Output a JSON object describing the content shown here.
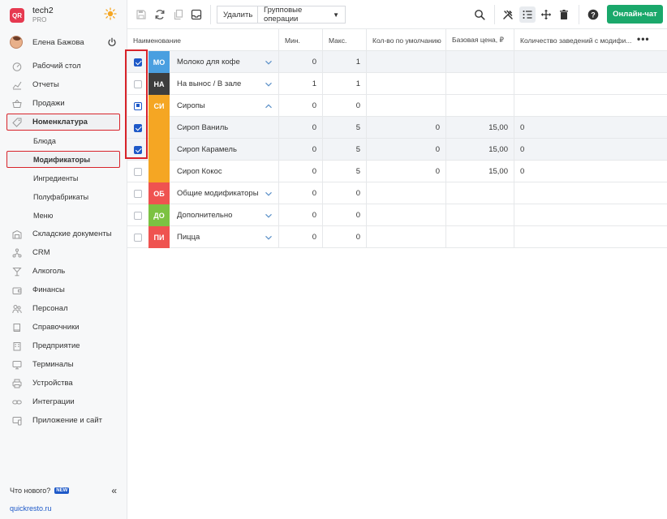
{
  "sidebar": {
    "brand": {
      "logo_text": "QR",
      "name": "tech2",
      "plan": "PRO"
    },
    "user": {
      "name": "Елена Бажова"
    },
    "nav": [
      {
        "label": "Рабочий стол",
        "icon": "dashboard-icon"
      },
      {
        "label": "Отчеты",
        "icon": "chart-icon"
      },
      {
        "label": "Продажи",
        "icon": "basket-icon"
      },
      {
        "label": "Номенклатура",
        "icon": "tag-icon",
        "highlighted": true,
        "children": [
          {
            "label": "Блюда"
          },
          {
            "label": "Модификаторы",
            "highlighted": true
          },
          {
            "label": "Ингредиенты"
          },
          {
            "label": "Полуфабрикаты"
          },
          {
            "label": "Меню"
          }
        ]
      },
      {
        "label": "Складские документы",
        "icon": "warehouse-icon"
      },
      {
        "label": "CRM",
        "icon": "crm-icon"
      },
      {
        "label": "Алкоголь",
        "icon": "glass-icon"
      },
      {
        "label": "Финансы",
        "icon": "wallet-icon"
      },
      {
        "label": "Персонал",
        "icon": "people-icon"
      },
      {
        "label": "Справочники",
        "icon": "book-icon"
      },
      {
        "label": "Предприятие",
        "icon": "building-icon"
      },
      {
        "label": "Терминалы",
        "icon": "terminal-icon"
      },
      {
        "label": "Устройства",
        "icon": "printer-icon"
      },
      {
        "label": "Интеграции",
        "icon": "link-icon"
      },
      {
        "label": "Приложение и сайт",
        "icon": "app-icon"
      }
    ],
    "whats_new": "Что нового?",
    "new_badge": "NEW",
    "site": "quickresto.ru"
  },
  "toolbar": {
    "delete_label": "Удалить",
    "group_ops_label": "Групповые операции",
    "chat_label": "Онлайн-чат"
  },
  "table": {
    "columns": [
      "Наименование",
      "Мин.",
      "Макс.",
      "Кол-во по умолчанию",
      "Базовая цена, ₽",
      "Количество заведений с модифи..."
    ],
    "rows": [
      {
        "check": "on",
        "tag": "МО",
        "tag_color": "#4a9fe0",
        "name": "Молоко для кофе",
        "min": "0",
        "max": "1",
        "def": "",
        "price": "",
        "cnt": "",
        "chevron": "down",
        "selected": true
      },
      {
        "check": "off",
        "tag": "НА",
        "tag_color": "#3d3d3d",
        "name": "На вынос / В зале",
        "min": "1",
        "max": "1",
        "def": "",
        "price": "",
        "cnt": "",
        "chevron": "down",
        "selected": false
      },
      {
        "check": "partial",
        "tag": "СИ",
        "tag_color": "#f5a623",
        "name": "Сиропы",
        "min": "0",
        "max": "0",
        "def": "",
        "price": "",
        "cnt": "",
        "chevron": "up",
        "selected": false
      },
      {
        "check": "on",
        "tag": "",
        "tag_color": "#f5a623",
        "name": "Сироп Ваниль",
        "min": "0",
        "max": "5",
        "def": "0",
        "price": "15,00",
        "cnt": "0",
        "chevron": "",
        "selected": true
      },
      {
        "check": "on",
        "tag": "",
        "tag_color": "#f5a623",
        "name": "Сироп Карамель",
        "min": "0",
        "max": "5",
        "def": "0",
        "price": "15,00",
        "cnt": "0",
        "chevron": "",
        "selected": true
      },
      {
        "check": "off",
        "tag": "",
        "tag_color": "#f5a623",
        "name": "Сироп Кокос",
        "min": "0",
        "max": "5",
        "def": "0",
        "price": "15,00",
        "cnt": "0",
        "chevron": "",
        "selected": false
      },
      {
        "check": "off",
        "tag": "ОБ",
        "tag_color": "#ef5350",
        "name": "Общие модификаторы",
        "min": "0",
        "max": "0",
        "def": "",
        "price": "",
        "cnt": "",
        "chevron": "down",
        "selected": false
      },
      {
        "check": "off",
        "tag": "ДО",
        "tag_color": "#7cc242",
        "name": "Дополнительно",
        "min": "0",
        "max": "0",
        "def": "",
        "price": "",
        "cnt": "",
        "chevron": "down",
        "selected": false
      },
      {
        "check": "off",
        "tag": "ПИ",
        "tag_color": "#ef5350",
        "name": "Пицца",
        "min": "0",
        "max": "0",
        "def": "",
        "price": "",
        "cnt": "",
        "chevron": "down",
        "selected": false
      }
    ]
  },
  "colors": {
    "accent": "#1e59c8",
    "highlight_frame": "#d8232a",
    "chat_button": "#1aa86b",
    "brand": "#e63950"
  }
}
